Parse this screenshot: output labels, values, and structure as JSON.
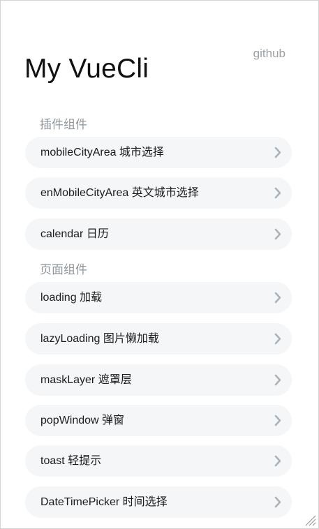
{
  "header": {
    "title": "My VueCli",
    "github_link": "github"
  },
  "sections": [
    {
      "heading": "插件组件",
      "items": [
        {
          "label": "mobileCityArea 城市选择"
        },
        {
          "label": "enMobileCityArea 英文城市选择"
        },
        {
          "label": "calendar 日历"
        }
      ]
    },
    {
      "heading": "页面组件",
      "items": [
        {
          "label": "loading 加载"
        },
        {
          "label": "lazyLoading 图片懒加载"
        },
        {
          "label": "maskLayer 遮罩层"
        },
        {
          "label": "popWindow 弹窗"
        },
        {
          "label": "toast 轻提示"
        },
        {
          "label": "DateTimePicker 时间选择"
        }
      ]
    }
  ],
  "icons": {
    "item_arrow": "chevron-right-icon",
    "resize_handle": "resize-grip-icon"
  },
  "colors": {
    "item_background": "#f5f6f7",
    "section_heading": "#8e969c",
    "link": "#9aa0a6",
    "chevron": "#a9b3bd"
  }
}
